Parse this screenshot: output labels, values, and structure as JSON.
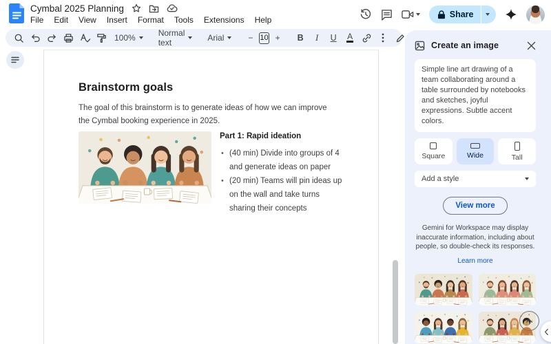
{
  "titlebar": {
    "title": "Cymbal 2025 Planning",
    "menus": [
      "File",
      "Edit",
      "View",
      "Insert",
      "Format",
      "Tools",
      "Extensions",
      "Help"
    ],
    "share_label": "Share"
  },
  "toolbar": {
    "zoom_value": "100%",
    "paragraph_style": "Normal text",
    "font_name": "Arial",
    "font_size": "10",
    "minus": "−",
    "plus": "+",
    "bold": "B",
    "italic": "I",
    "underline": "U",
    "text_color": "A"
  },
  "document": {
    "heading": "Brainstorm goals",
    "intro": "The goal of this brainstorm is to generate ideas of how we can improve the Cymbal booking experience in 2025.",
    "image_alt": "Line art illustration of four teammates collaborating around a table covered with notebooks and sketches",
    "section_title": "Part 1: Rapid ideation",
    "bullets": [
      "(40 min) Divide into groups of 4 and generate ideas on paper",
      "(20 min) Teams will pin ideas up on the wall and take turns sharing their concepts"
    ]
  },
  "sidebar": {
    "title": "Create an image",
    "prompt": "Simple line art drawing of a team collaborating around a table surrounded by notebooks and sketches, joyful expressions. Subtle accent colors.",
    "aspect_options": [
      {
        "label": "Square",
        "selected": false
      },
      {
        "label": "Wide",
        "selected": true
      },
      {
        "label": "Tall",
        "selected": false
      }
    ],
    "style_placeholder": "Add a style",
    "view_more_label": "View more",
    "disclaimer": "Gemini for Workspace may display inaccurate information, including about people, so double-check its responses.",
    "learn_more_label": "Learn more",
    "thumbnails": [
      "Generated image 1: line art team around a table, teal and rust accents",
      "Generated image 2: line art team around a table, sage and rose accents",
      "Generated image 3: line art team around a table, blue and yellow accents",
      "Generated image 4: line art team around a table, olive and red accents"
    ]
  },
  "colors": {
    "accent_blue": "#0b57d0",
    "share_button_bg": "#c2e7ff",
    "selected_chip_bg": "#d3e3fd",
    "panel_bg": "#ecf1fb",
    "toolbar_bg": "#edf2fa",
    "doc_image_bg": "#efebe1"
  }
}
